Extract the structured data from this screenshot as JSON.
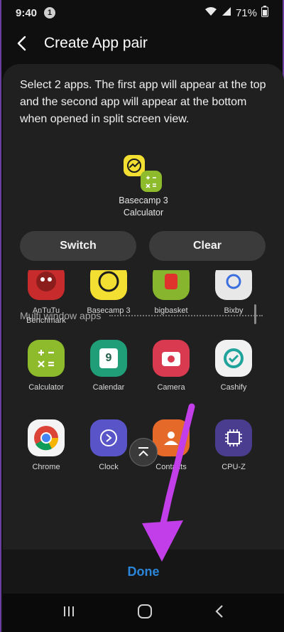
{
  "status": {
    "time": "9:40",
    "notification_count": "1",
    "battery": "71%"
  },
  "header": {
    "title": "Create App pair"
  },
  "description": "Select 2 apps. The first app will appear at the top and the second app will appear at the bottom when opened in split screen view.",
  "pair": {
    "first": "Basecamp 3",
    "second": "Calculator"
  },
  "buttons": {
    "switch": "Switch",
    "clear": "Clear",
    "done": "Done"
  },
  "section": {
    "label": "Multi window apps"
  },
  "apps": [
    {
      "label": "AnTuTu Benchmark",
      "color": "#c72b2b"
    },
    {
      "label": "Basecamp 3",
      "color": "#f3df32"
    },
    {
      "label": "bigbasket",
      "color": "#87b62e"
    },
    {
      "label": "Bixby",
      "color": "#e8e8e8"
    },
    {
      "label": "Calculator",
      "color": "#8dbb2c"
    },
    {
      "label": "Calendar",
      "color": "#1f9e78"
    },
    {
      "label": "Camera",
      "color": "#d93a4f"
    },
    {
      "label": "Cashify",
      "color": "#f1f1f1"
    },
    {
      "label": "Chrome",
      "color": "#f4f4f4"
    },
    {
      "label": "Clock",
      "color": "#5a54c9"
    },
    {
      "label": "Contacts",
      "color": "#e56a2a"
    },
    {
      "label": "CPU-Z",
      "color": "#4a3d8f"
    }
  ],
  "calendar_day": "9",
  "calc_symbols": "+−×÷",
  "accent_arrow": "#c23ee8"
}
